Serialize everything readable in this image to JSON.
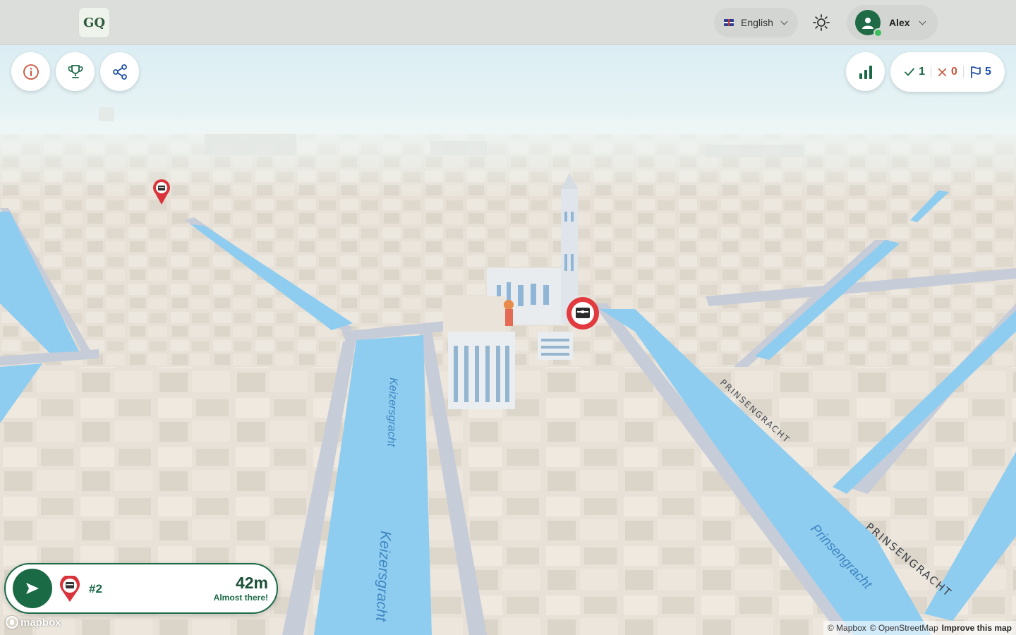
{
  "header": {
    "logo_text": "GQ",
    "language": {
      "label": "English",
      "flag": "uk-flag-icon"
    },
    "theme_icon": "sun-icon",
    "user": {
      "name": "Alex",
      "online": true
    }
  },
  "toolbar_left": [
    {
      "icon": "info-icon"
    },
    {
      "icon": "trophy-icon"
    },
    {
      "icon": "share-icon"
    }
  ],
  "leaderboard_icon": "bar-chart-icon",
  "stats": {
    "correct": "1",
    "wrong": "0",
    "flags": "5",
    "colors": {
      "correct": "#1b6a46",
      "wrong": "#c8553a",
      "flags": "#1e4fa8"
    }
  },
  "map": {
    "labels": [
      {
        "text": "Keizersgracht",
        "kind": "water"
      },
      {
        "text": "Keizersgracht",
        "kind": "water"
      },
      {
        "text": "PRINSENGRACHT",
        "kind": "street"
      },
      {
        "text": "PRINSENGRACHT",
        "kind": "street"
      },
      {
        "text": "Prinsengracht",
        "kind": "water"
      }
    ],
    "markers": [
      {
        "icon": "treasure-chest-icon",
        "size": "small"
      },
      {
        "icon": "treasure-chest-icon",
        "size": "large"
      }
    ],
    "colors": {
      "water": "#8fcdf0",
      "building": "#e8e2d8",
      "road": "#c6ccd8",
      "fog": "#dff0f5"
    }
  },
  "navigation": {
    "number": "#2",
    "distance": "42m",
    "status": "Almost there!"
  },
  "mapbox_logo": "mapbox",
  "attribution": {
    "mapbox": "© Mapbox",
    "osm": "© OpenStreetMap",
    "improve": "Improve this map"
  }
}
